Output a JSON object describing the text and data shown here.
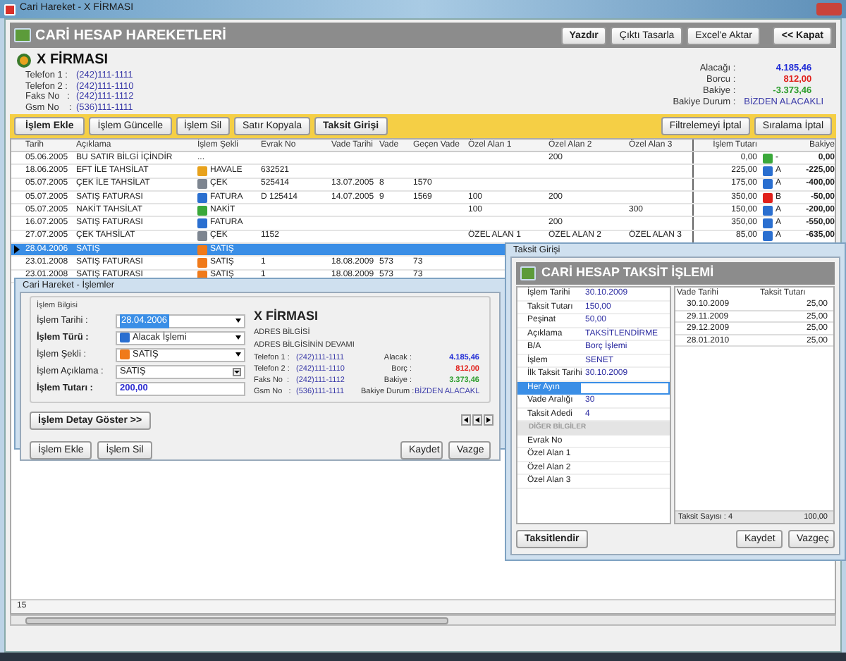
{
  "window": {
    "title": "Cari Hareket - X FİRMASI"
  },
  "header": {
    "title": "CARİ HESAP HAREKETLERİ",
    "buttons": [
      {
        "label": "Yazdır",
        "primary": true
      },
      {
        "label": "Çıktı Tasarla",
        "primary": false
      },
      {
        "label": "Excel'e Aktar",
        "primary": false
      },
      {
        "label": "<< Kapat",
        "primary": true
      }
    ]
  },
  "company": {
    "name": "X FİRMASI",
    "contacts": [
      {
        "label": "Telefon 1 :",
        "value": "(242)111-1111"
      },
      {
        "label": "Telefon 2 :",
        "value": "(242)111-1110"
      },
      {
        "label": "Faks No   :",
        "value": "(242)111-1112"
      },
      {
        "label": "Gsm No    :",
        "value": "(536)111-1111"
      }
    ],
    "totals": [
      {
        "label": "Alacağı :",
        "value": "4.185,46",
        "color": "#1f2bd6"
      },
      {
        "label": "Borcu :",
        "value": "812,00",
        "color": "#e0201b"
      },
      {
        "label": "Bakiye :",
        "value": "-3.373,46",
        "color": "#2f9e2f"
      },
      {
        "label": "Bakiye Durum :",
        "value": "BİZDEN ALACAKLI",
        "color": "#3a3aa8"
      }
    ]
  },
  "toolbar": {
    "buttons": [
      {
        "label": "İşlem Ekle",
        "primary": true
      },
      {
        "label": "İşlem Güncelle",
        "primary": false
      },
      {
        "label": "İşlem Sil",
        "primary": false
      },
      {
        "label": "Satır Kopyala",
        "primary": false
      },
      {
        "label": "Taksit Girişi",
        "primary": true
      }
    ],
    "right_buttons": [
      "Filtrelemeyi İptal",
      "Sıralama İptal"
    ]
  },
  "table": {
    "columns": [
      "Tarih",
      "Açıklama",
      "İşlem Şekli",
      "Evrak No",
      "Vade Tarihi",
      "Vade",
      "Geçen Vade",
      "Özel Alan 1",
      "Özel Alan 2",
      "Özel Alan 3",
      "İşlem Tutarı",
      "Bakiye"
    ],
    "rows": [
      {
        "selected": false,
        "date": "05.06.2005",
        "description": "BU SATIR BİLGİ İÇİNDİR",
        "type": {
          "label": "..."
        },
        "custom_2": "200",
        "amount": "0,00",
        "flag": {
          "label": "-",
          "color": "#3aa83a"
        },
        "balance": "0,00"
      },
      {
        "selected": false,
        "date": "18.06.2005",
        "description": "EFT İLE TAHSİLAT",
        "type": {
          "label": "HAVALE",
          "color": "#e8a21c"
        },
        "document": "632521",
        "amount": "225,00",
        "flag": {
          "label": "A",
          "color": "#2a6fd0"
        },
        "balance": "-225,00"
      },
      {
        "selected": false,
        "date": "05.07.2005",
        "description": "ÇEK İLE TAHSİLAT",
        "type": {
          "label": "ÇEK",
          "color": "#7d8590"
        },
        "document": "525414",
        "due_date": "13.07.2005",
        "due": "8",
        "elapsed": "1570",
        "amount": "175,00",
        "flag": {
          "label": "A",
          "color": "#2a6fd0"
        },
        "balance": "-400,00"
      },
      {
        "selected": false,
        "date": "05.07.2005",
        "description": "SATIŞ FATURASI",
        "type": {
          "label": "FATURA",
          "color": "#2a6fd0"
        },
        "document": "D 125414",
        "due_date": "14.07.2005",
        "due": "9",
        "elapsed": "1569",
        "custom_1": "100",
        "custom_2": "200",
        "amount": "350,00",
        "flag": {
          "label": "B",
          "color": "#e0201b"
        },
        "balance": "-50,00"
      },
      {
        "selected": false,
        "date": "05.07.2005",
        "description": "NAKİT TAHSİLAT",
        "type": {
          "label": "NAKİT",
          "color": "#3aa83a"
        },
        "custom_1": "100",
        "custom_3": "300",
        "amount": "150,00",
        "flag": {
          "label": "A",
          "color": "#2a6fd0"
        },
        "balance": "-200,00"
      },
      {
        "selected": false,
        "date": "16.07.2005",
        "description": "SATIŞ FATURASI",
        "type": {
          "label": "FATURA",
          "color": "#2a6fd0"
        },
        "custom_2": "200",
        "amount": "350,00",
        "flag": {
          "label": "A",
          "color": "#2a6fd0"
        },
        "balance": "-550,00"
      },
      {
        "selected": false,
        "date": "27.07.2005",
        "description": "ÇEK TAHSİLAT",
        "type": {
          "label": "ÇEK",
          "color": "#7d8590"
        },
        "document": "1152",
        "custom_1": "ÖZEL ALAN 1",
        "custom_2": "ÖZEL ALAN 2",
        "custom_3": "ÖZEL ALAN 3",
        "amount": "85,00",
        "flag": {
          "label": "A",
          "color": "#2a6fd0"
        },
        "balance": "-635,00"
      },
      {
        "selected": true,
        "date": "28.04.2006",
        "description": "SATIŞ",
        "type": {
          "label": "SATIŞ",
          "color": "#f07a1a"
        }
      },
      {
        "selected": false,
        "date": "23.01.2008",
        "description": "SATIŞ FATURASI",
        "type": {
          "label": "SATIŞ",
          "color": "#f07a1a"
        },
        "document": "1",
        "due_date": "18.08.2009",
        "due": "573",
        "elapsed": "73"
      },
      {
        "selected": false,
        "date": "23.01.2008",
        "description": "SATIŞ FATURASI",
        "type": {
          "label": "SATIŞ",
          "color": "#f07a1a"
        },
        "document": "1",
        "due_date": "18.08.2009",
        "due": "573",
        "elapsed": "73"
      }
    ]
  },
  "status_bar": {
    "count": "15"
  },
  "operations_dialog": {
    "title": "Cari Hareket - İşlemler",
    "group": "İşlem Bilgisi",
    "fields": [
      {
        "label": "İşlem Tarihi :",
        "value": "28.04.2006",
        "kind": "date",
        "bold": false
      },
      {
        "label": "İşlem Türü :",
        "value": "Alacak İşlemi",
        "kind": "dropdown",
        "bold": true,
        "color": "#2a6fd0"
      },
      {
        "label": "İşlem Şekli :",
        "value": "SATIŞ",
        "kind": "dropdown",
        "bold": false,
        "color": "#f07a1a"
      },
      {
        "label": "İşlem Açıklama :",
        "value": "SATIŞ",
        "kind": "combo",
        "bold": false
      },
      {
        "label": "İşlem Tutarı :",
        "value": "200,00",
        "kind": "amount",
        "bold": true
      }
    ],
    "company": "X FİRMASI",
    "address": [
      "ADRES BİLGİSİ",
      "ADRES BİLGİSİNİN DEVAMI"
    ],
    "contacts": [
      {
        "label": "Telefon 1 :",
        "value": "(242)111-1111",
        "total_label": "Alacak :",
        "total": "4.185,46",
        "color": "#1f2bd6"
      },
      {
        "label": "Telefon 2 :",
        "value": "(242)111-1110",
        "total_label": "Borç :",
        "total": "812,00",
        "color": "#e0201b"
      },
      {
        "label": "Faks No  :",
        "value": "(242)111-1112",
        "total_label": "Bakiye :",
        "total": "3.373,46",
        "color": "#2f9e2f"
      },
      {
        "label": "Gsm No   :",
        "value": "(536)111-1111",
        "total_label": "Bakiye Durum :",
        "total": "BİZDEN ALACAKL",
        "color": "#3a3aa8"
      }
    ],
    "detail_button": "İşlem Detay Göster >>",
    "bottom_buttons": [
      "İşlem Ekle",
      "İşlem Sil"
    ],
    "right_buttons": [
      "Kaydet",
      "Vazge"
    ]
  },
  "installment_dialog": {
    "title": "Taksit Girişi",
    "heading": "CARİ HESAP TAKSİT İŞLEMİ",
    "properties": [
      {
        "kind": "row",
        "label": "İşlem Tarihi",
        "value": "30.10.2009",
        "selected": false
      },
      {
        "kind": "row",
        "label": "Taksit Tutarı",
        "value": "150,00",
        "selected": false
      },
      {
        "kind": "row",
        "label": "Peşinat",
        "value": "50,00",
        "selected": false
      },
      {
        "kind": "row",
        "label": "Açıklama",
        "value": "TAKSİTLENDİRME",
        "selected": false
      },
      {
        "kind": "row",
        "label": "B/A",
        "value": "Borç İşlemi",
        "selected": false
      },
      {
        "kind": "row",
        "label": "İşlem",
        "value": "SENET",
        "selected": false
      },
      {
        "kind": "row",
        "label": "İlk Taksit Tarihi",
        "value": "30.10.2009",
        "selected": false
      },
      {
        "kind": "row",
        "label": "Her Ayın",
        "selected": true
      },
      {
        "kind": "row",
        "label": "Vade Aralığı",
        "value": "30",
        "selected": false
      },
      {
        "kind": "row",
        "label": "Taksit Adedi",
        "value": "4",
        "selected": false
      },
      {
        "kind": "section",
        "label": "DİĞER BİLGİLER",
        "selected": false
      },
      {
        "kind": "row",
        "label": "Evrak No",
        "selected": false
      },
      {
        "kind": "row",
        "label": "Özel Alan 1",
        "selected": false
      },
      {
        "kind": "row",
        "label": "Özel Alan 2",
        "selected": false
      },
      {
        "kind": "row",
        "label": "Özel Alan 3",
        "selected": false
      }
    ],
    "columns": [
      "Vade Tarihi",
      "Taksit Tutarı"
    ],
    "rows": [
      [
        "30.10.2009",
        "25,00"
      ],
      [
        "29.11.2009",
        "25,00"
      ],
      [
        "29.12.2009",
        "25,00"
      ],
      [
        "28.01.2010",
        "25,00"
      ]
    ],
    "footer": {
      "count": "Taksit Sayısı : 4",
      "total": "100,00"
    },
    "left_button": "Taksitlendir",
    "right_buttons": [
      "Kaydet",
      "Vazgeç"
    ]
  }
}
